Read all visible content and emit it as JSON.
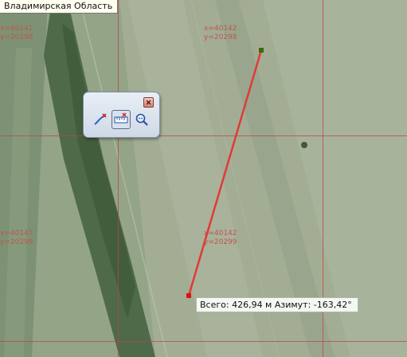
{
  "region_label": "Владимирская Область",
  "grid_labels": [
    {
      "x": "x=40141",
      "y": "y=20298"
    },
    {
      "x": "x=40142",
      "y": "y=20298"
    },
    {
      "x": "x=40141",
      "y": "y=20299"
    },
    {
      "x": "x=40142",
      "y": "y=20299"
    }
  ],
  "toolbar": {
    "tools": [
      "ruler-line-icon",
      "ruler-measure-icon",
      "zoom-icon"
    ],
    "active_tool": "ruler-measure-icon",
    "close_icon": "close-icon"
  },
  "measurement": {
    "text": "Всего: 426,94 м Азимут: -163,42°"
  },
  "colors": {
    "grid_line": "#b8454a",
    "grid_label": "#c0554f",
    "measure_line": "#e03a3a",
    "start_point": "#e01010",
    "end_point": "#3a6a10"
  }
}
